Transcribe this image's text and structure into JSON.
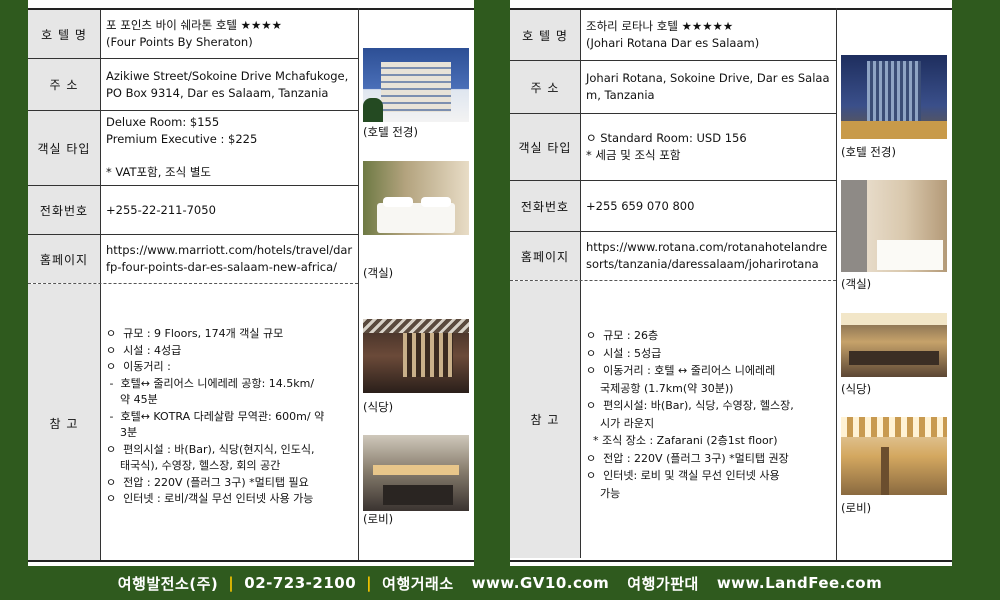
{
  "left": {
    "labels": {
      "name": "호 텔 명",
      "address": "주   소",
      "rooms": "객실 타입",
      "phone": "전화번호",
      "homepage": "홈페이지",
      "notes": "참   고"
    },
    "name_ko": "포 포인츠 바이 쉐라톤 호텔 ★★★★",
    "name_en": "(Four Points By Sheraton)",
    "address": "Azikiwe Street/Sokoine Drive Mchafukoge, PO Box 9314, Dar es Salaam, Tanzania",
    "rooms_line1": "Deluxe Room: $155",
    "rooms_line2": "Premium Executive : $225",
    "rooms_line3": "* VAT포함, 조식 별도",
    "phone": "+255-22-211-7050",
    "homepage": "https://www.marriott.com/hotels/travel/darfp-four-points-dar-es-salaam-new-africa/",
    "notes": [
      "ㅇ  규모 : 9 Floors, 174개 객실 규모",
      "ㅇ  시설 : 4성급",
      "ㅇ  이동거리 :",
      " -  호텔↔ 줄리어스 니에레레 공항: 14.5km/",
      "    약 45분",
      " -  호텔↔ KOTRA 다레살람 무역관: 600m/ 약",
      "    3분",
      "ㅇ  편의시설 : 바(Bar), 식당(현지식, 인도식,",
      "    태국식), 수영장, 헬스장, 회의 공간",
      "ㅇ  전압 : 220V (플러그 3구) *멀티탭 필요",
      "ㅇ  인터넷 : 로비/객실 무선 인터넷 사용 가능"
    ],
    "captions": [
      "(호텔 전경)",
      "(객실)",
      "(식당)",
      "(로비)"
    ]
  },
  "right": {
    "labels": {
      "name": "호 텔 명",
      "address": "주   소",
      "rooms": "객실 타입",
      "phone": "전화번호",
      "homepage": "홈페이지",
      "notes": "참   고"
    },
    "name_ko": "조하리 로타나 호텔 ★★★★★",
    "name_en": "(Johari Rotana Dar es Salaam)",
    "address": "Johari Rotana, Sokoine Drive, Dar es Salaam, Tanzania",
    "rooms_line1": "ㅇ  Standard Room: USD 156",
    "rooms_line2": "* 세금 및 조식 포함",
    "phone": "+255  659  070  800",
    "homepage": "https://www.rotana.com/rotanahotelandresorts/tanzania/daressalaam/joharirotana",
    "notes": [
      "ㅇ  규모 : 26층",
      "ㅇ  시설 : 5성급",
      "ㅇ  이동거리 : 호텔 ↔ 줄리어스 니에레레",
      "    국제공항 (1.7km(약 30분))",
      "ㅇ  편의시설: 바(Bar), 식당, 수영장, 헬스장,",
      "    시가 라운지",
      "  * 조식 장소 : Zafarani (2층1st floor)",
      "ㅇ  전압 : 220V (플러그 3구) *멀티탭 권장",
      "ㅇ  인터넷: 로비 및 객실 무선 인터넷 사용",
      "    가능"
    ],
    "captions": [
      "(호텔 전경)",
      "(객실)",
      "(식당)",
      "(로비)"
    ]
  },
  "footer": {
    "company": "여행발전소(주)",
    "phone": "02-723-2100",
    "label1": "여행거래소",
    "site1": "www.GV10.com",
    "label2": "여행가판대",
    "site2": "www.LandFee.com"
  },
  "colors": {
    "background": "#2f5a1e",
    "label_cell": "#e6e6e6",
    "separator": "#f2c200"
  }
}
